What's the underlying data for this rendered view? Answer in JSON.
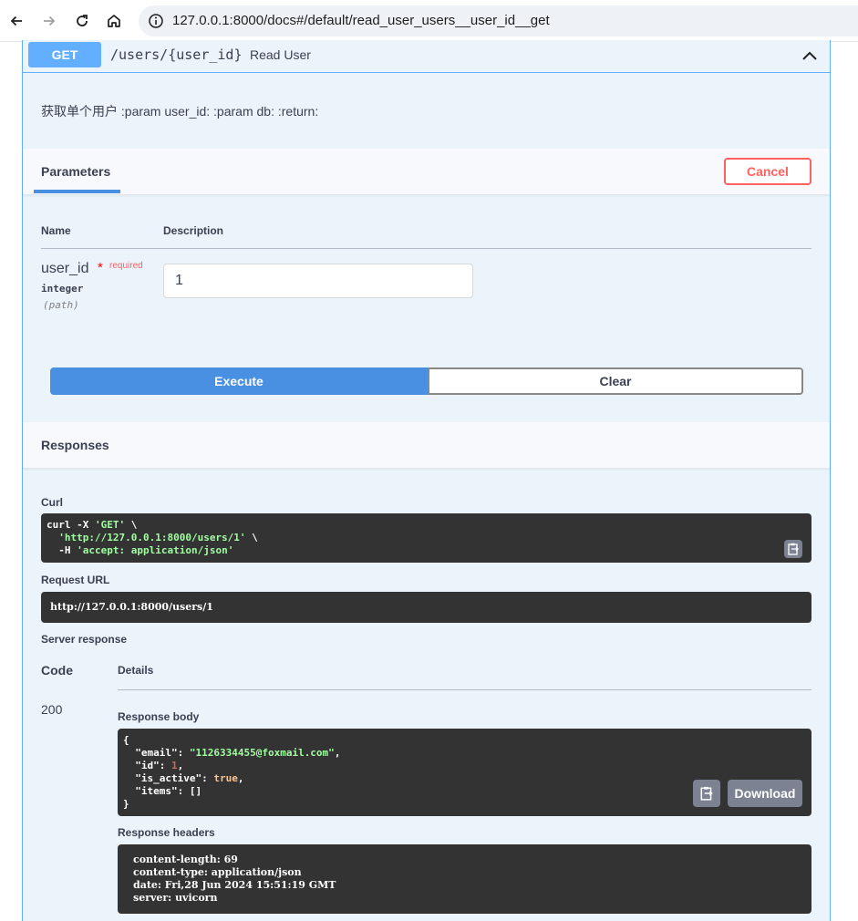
{
  "browser": {
    "url": "127.0.0.1:8000/docs#/default/read_user_users__user_id__get"
  },
  "operation": {
    "method": "GET",
    "path": "/users/{user_id}",
    "summary": "Read User",
    "description": "获取单个用户 :param user_id: :param db: :return:"
  },
  "parameters": {
    "tab_label": "Parameters",
    "cancel_label": "Cancel",
    "col_name": "Name",
    "col_description": "Description",
    "items": [
      {
        "name": "user_id",
        "required_star": "*",
        "required_text": "required",
        "type": "integer",
        "in": "(path)",
        "value": "1"
      }
    ]
  },
  "actions": {
    "execute_label": "Execute",
    "clear_label": "Clear"
  },
  "responses": {
    "title": "Responses",
    "curl_label": "Curl",
    "curl": {
      "line1_cmd": "curl -X ",
      "line1_method": "'GET'",
      "line1_tail": " \\",
      "line2_url": "'http://127.0.0.1:8000/users/1'",
      "line2_tail": " \\",
      "line3_flag": "  -H ",
      "line3_header": "'accept: application/json'"
    },
    "request_url_label": "Request URL",
    "request_url": "http://127.0.0.1:8000/users/1",
    "server_response_label": "Server response",
    "col_code": "Code",
    "col_details": "Details",
    "code": "200",
    "response_body_label": "Response body",
    "body": {
      "open": "{",
      "email_key": "  \"email\": ",
      "email_val": "\"1126334455@foxmail.com\"",
      "id_key": "  \"id\": ",
      "id_val": "1",
      "is_active_key": "  \"is_active\": ",
      "is_active_val": "true",
      "items_line": "  \"items\": []",
      "close": "}"
    },
    "download_label": "Download",
    "response_headers_label": "Response headers",
    "headers": [
      "content-length: 69",
      "content-type: application/json",
      "date: Fri,28 Jun 2024 15:51:19 GMT",
      "server: uvicorn"
    ]
  }
}
